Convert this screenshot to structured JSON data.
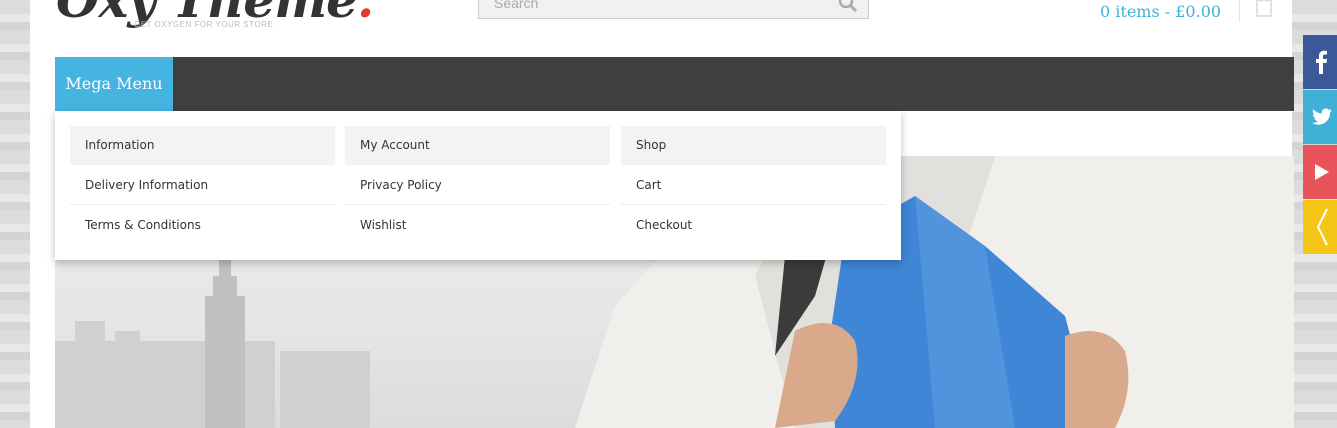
{
  "header": {
    "logo_text": "Oxy Theme",
    "logo_dot": ".",
    "tagline": "GET OXYGEN FOR YOUR STORE",
    "search_placeholder": "Search",
    "cart_total": "0 items - £0.00"
  },
  "nav": {
    "mega_menu_label": "Mega Menu"
  },
  "mega_menu": {
    "columns": [
      {
        "heading": "Information",
        "links": [
          "Delivery Information",
          "Terms & Conditions"
        ]
      },
      {
        "heading": "My Account",
        "links": [
          "Privacy Policy",
          "Wishlist"
        ]
      },
      {
        "heading": "Shop",
        "links": [
          "Cart",
          "Checkout"
        ]
      }
    ]
  },
  "social": [
    {
      "name": "facebook",
      "icon": "facebook-icon",
      "color": "#3b5998"
    },
    {
      "name": "twitter",
      "icon": "twitter-icon",
      "color": "#3fb1d6"
    },
    {
      "name": "youtube",
      "icon": "play-icon",
      "color": "#e8545a"
    },
    {
      "name": "toggle",
      "icon": "chevron-left-icon",
      "color": "#f5c518"
    }
  ],
  "colors": {
    "accent": "#46b4e1",
    "navbar": "#404040",
    "cart_text": "#3fb1d6"
  }
}
